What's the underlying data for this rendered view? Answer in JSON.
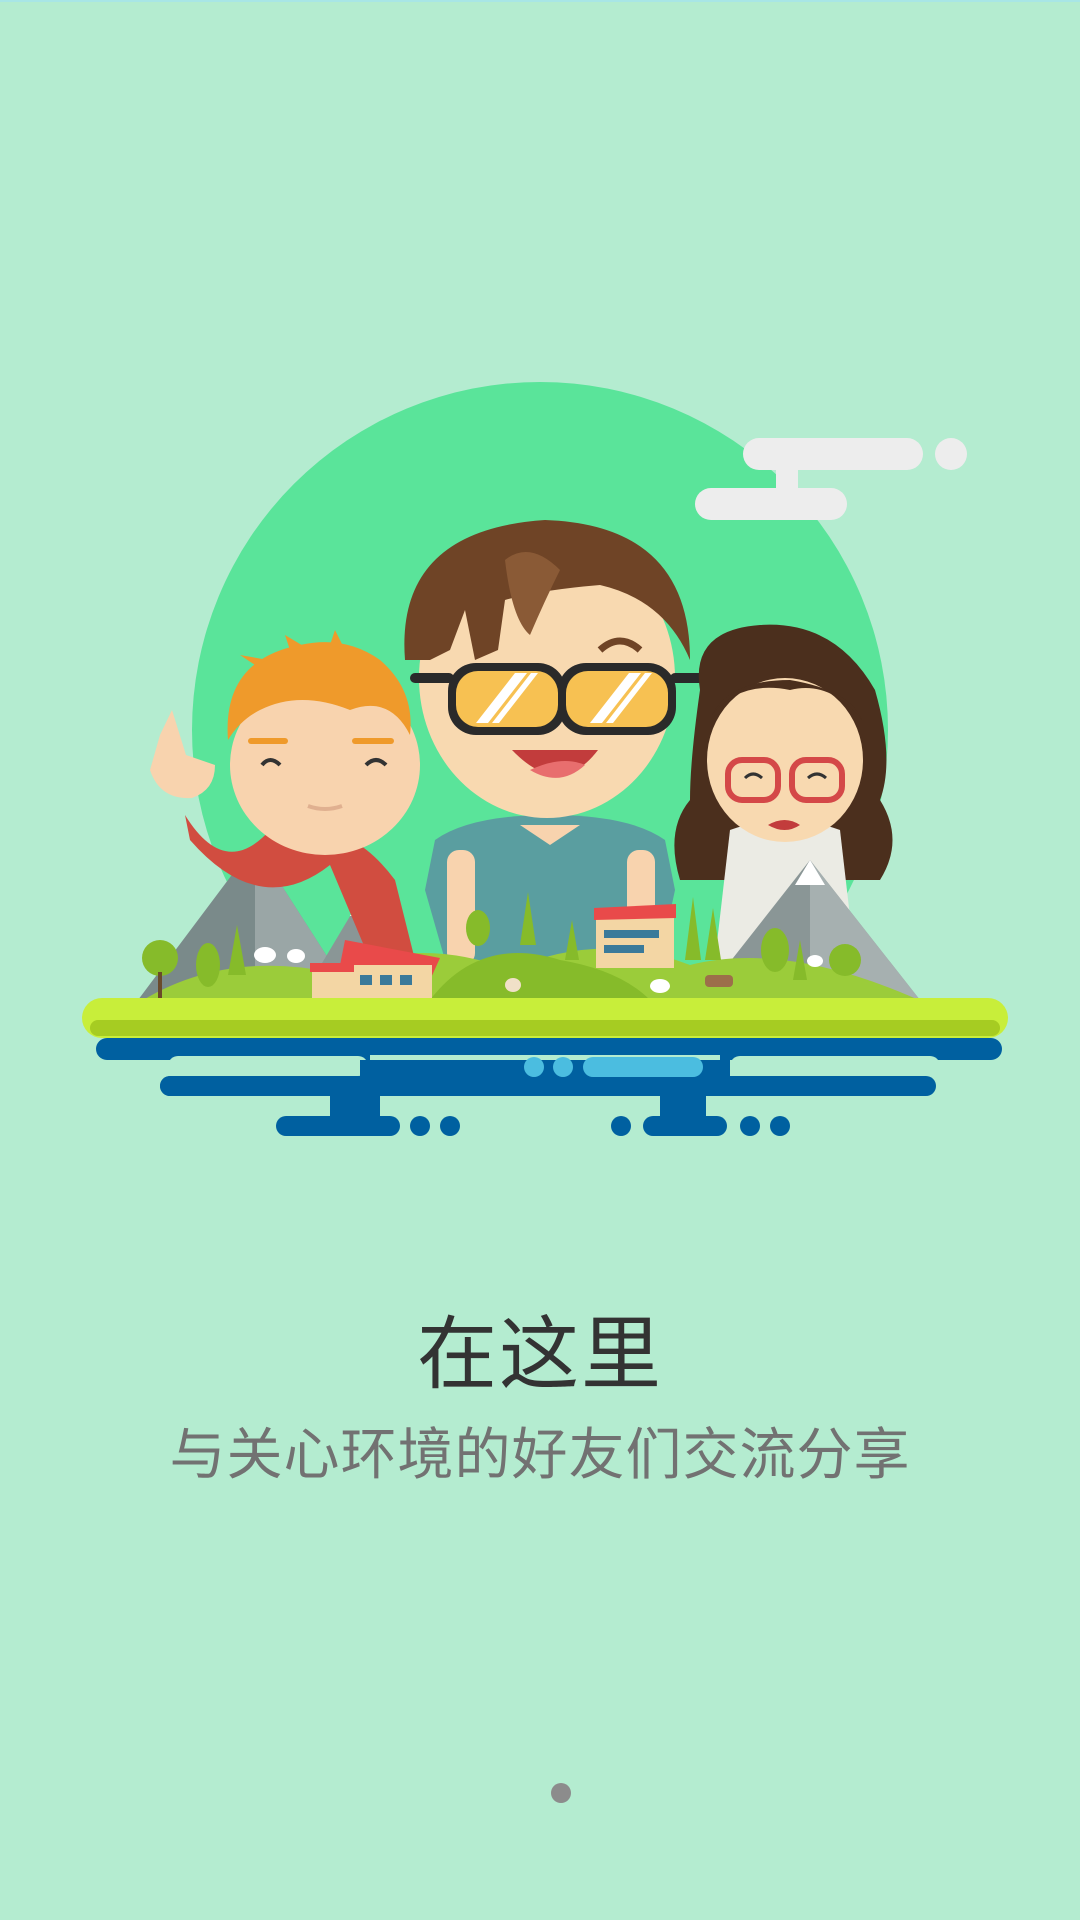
{
  "onboarding": {
    "headline": "在这里",
    "subline": "与关心环境的好友们交流分享",
    "page_indicator": {
      "total_visible_dots": 1,
      "active_index": 0
    }
  },
  "colors": {
    "background": "#b4ecd0",
    "sun_circle": "#5ae49a",
    "headline_text": "#333333",
    "subline_text": "#727272",
    "water_dark": "#0060a0",
    "water_light": "#4bbde0",
    "grass": "#c8ee3a",
    "pager_dot": "#8c8c8c"
  },
  "illustration": {
    "subject": "three-friends-on-green-island-scene",
    "characters": [
      "boy-pointing",
      "boy-with-sunglasses",
      "girl-with-red-glasses"
    ]
  }
}
